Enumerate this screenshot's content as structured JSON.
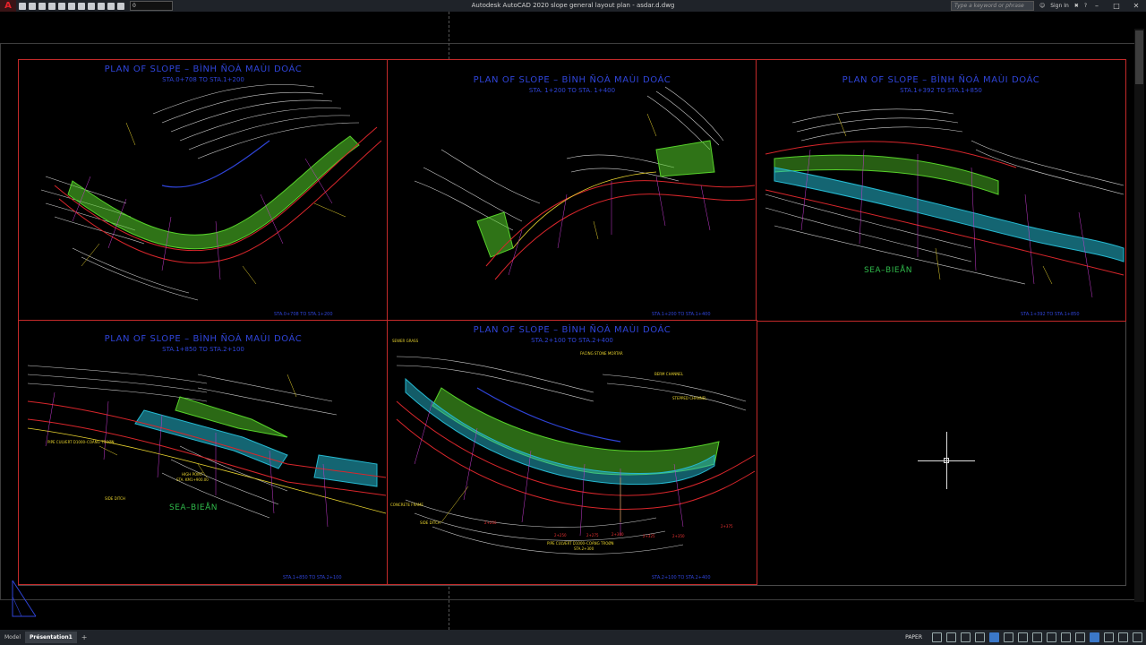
{
  "window": {
    "title": "Autodesk AutoCAD 2020   slope general layout plan - asdar.d.dwg",
    "workspace_value": "0",
    "search_placeholder": "Type a keyword or phrase",
    "sign_in": "Sign In"
  },
  "viewports": [
    {
      "title": "PLAN OF SLOPE – BÌNH ÑOÀ MAÙI DOÁC",
      "subtitle": "STA.0+708  TO  STA.1+200",
      "footer": "STA.0+708 TO STA.1+200"
    },
    {
      "title": "PLAN OF SLOPE – BÌNH ÑOÀ MAÙI DOÁC",
      "subtitle": "STA. 1+200  TO  STA. 1+400",
      "footer": "STA.1+200 TO STA.1+400"
    },
    {
      "title": "PLAN OF SLOPE – BÌNH ÑOÀ MAÙI DOÁC",
      "subtitle": "STA.1+392 TO STA.1+850",
      "footer": "STA.1+392 TO STA.1+850",
      "sea": "SEA–BIEÅN"
    },
    {
      "title": "PLAN OF SLOPE – BÌNH ÑOÀ MAÙI DOÁC",
      "subtitle": "STA.1+850  TO  STA.2+100",
      "footer": "STA.1+850 TO STA.2+100",
      "sea": "SEA–BIEÅN"
    },
    {
      "title": "PLAN OF SLOPE – BÌNH ÑOÀ MAÙI DOÁC",
      "subtitle": "STA.2+100  TO  STA.2+400",
      "footer": "STA.2+100 TO STA.2+400"
    }
  ],
  "labels": {
    "concrete_frame": "CONCRETE FRAME",
    "side_ditch": "SIDE DITCH",
    "pipe_culvert": "PIPE CULVERT D1000–COÁNG TROØN",
    "pipe_culvert_sta": "STA.2+300",
    "facing_stone": "FACING STONE MORTAR",
    "sewer_grass": "SEWER GRASS",
    "berm_channel": "BERM CHANNEL",
    "stepped_channel": "STEPPED CHANNEL",
    "high_point": "HIGH POINT",
    "high_point_sta": "STA. KM1+900.00",
    "sta_2_200": "2+200",
    "sta_2_250": "2+250",
    "sta_2_275": "2+275",
    "sta_2_300": "2+300",
    "sta_2_325": "2+325",
    "sta_2_350": "2+350",
    "sta_2_375": "2+375"
  },
  "statusbar": {
    "tabs": [
      "Model",
      "Présentation1",
      "+"
    ],
    "active_tab": "Présentation1",
    "space": "PAPER"
  },
  "colors": {
    "viewport_border": "#c42a2a",
    "title_blue": "#2f44d8",
    "label_yellow": "#e6d12e",
    "fill_green": "#56d12a",
    "fill_cyan": "#25b8d0",
    "road_red": "#d8262b",
    "contour_white": "#dedede",
    "grid_magenta": "#c63bd0"
  }
}
